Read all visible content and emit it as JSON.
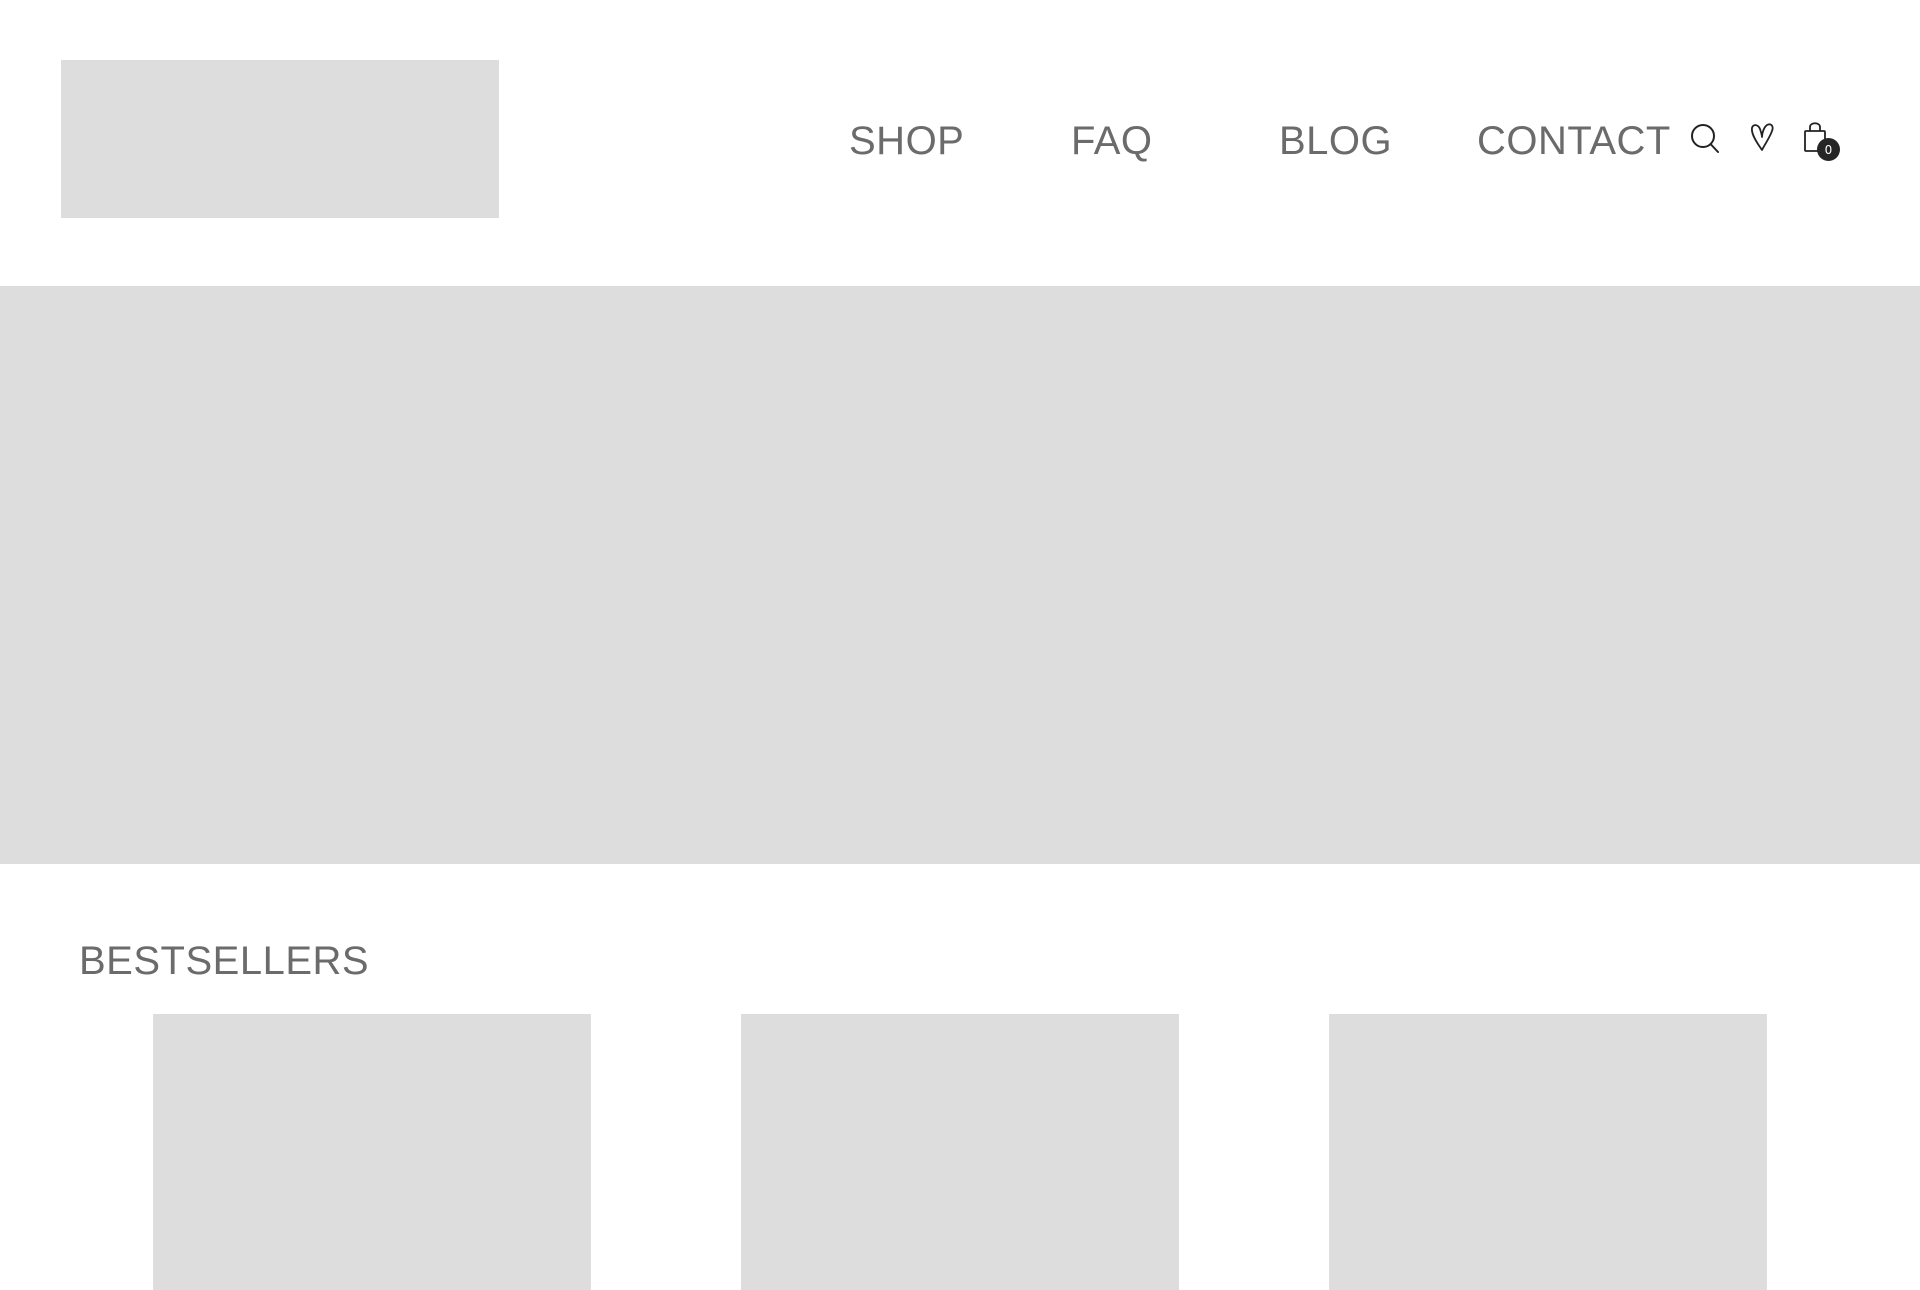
{
  "header": {
    "nav": {
      "shop": "SHOP",
      "faq": "FAQ",
      "blog": "BLOG",
      "contact": "CONTACT"
    },
    "icons": {
      "search": "search-icon",
      "wishlist": "heart-icon",
      "cart": "shopping-bag-icon"
    },
    "cart_count": "0"
  },
  "bestsellers": {
    "title": "BESTSELLERS"
  },
  "colors": {
    "placeholder": "#dddddd",
    "text": "#6b6b6b",
    "badge": "#262626"
  }
}
